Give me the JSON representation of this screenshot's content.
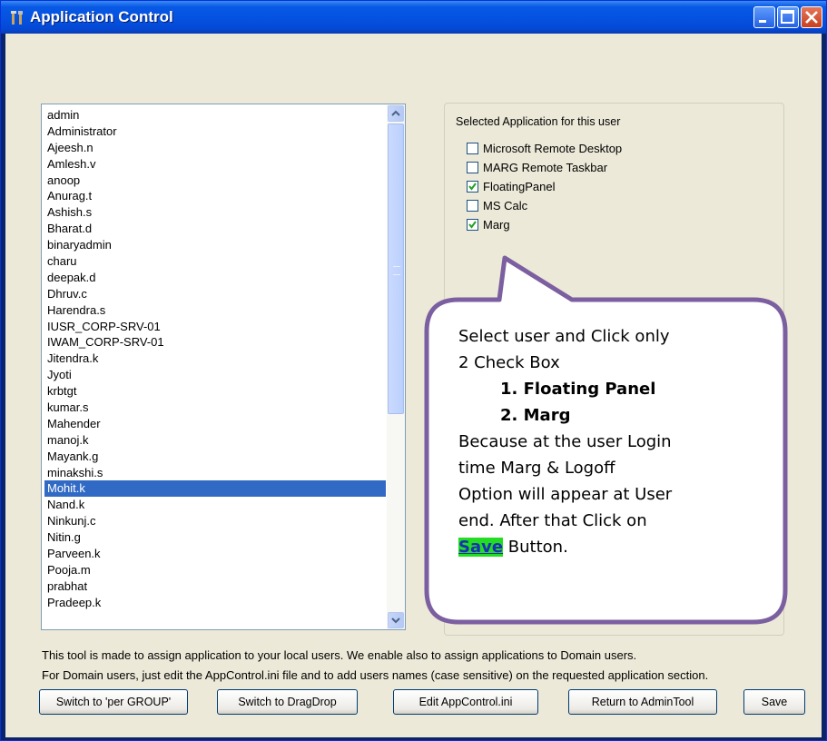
{
  "window": {
    "title": "Application Control"
  },
  "users": {
    "items": [
      "admin",
      "Administrator",
      "Ajeesh.n",
      "Amlesh.v",
      "anoop",
      "Anurag.t",
      "Ashish.s",
      "Bharat.d",
      "binaryadmin",
      "charu",
      "deepak.d",
      "Dhruv.c",
      "Harendra.s",
      "IUSR_CORP-SRV-01",
      "IWAM_CORP-SRV-01",
      "Jitendra.k",
      "Jyoti",
      "krbtgt",
      "kumar.s",
      "Mahender",
      "manoj.k",
      "Mayank.g",
      "minakshi.s",
      "Mohit.k",
      "Nand.k",
      "Ninkunj.c",
      "Nitin.g",
      "Parveen.k",
      "Pooja.m",
      "prabhat",
      "Pradeep.k"
    ],
    "selected_index": 23
  },
  "applications": {
    "label": "Selected Application for this user",
    "items": [
      {
        "label": "Microsoft Remote Desktop",
        "checked": false
      },
      {
        "label": "MARG Remote Taskbar",
        "checked": false
      },
      {
        "label": "FloatingPanel",
        "checked": true
      },
      {
        "label": "MS Calc",
        "checked": false
      },
      {
        "label": "Marg",
        "checked": true
      }
    ]
  },
  "info": {
    "line1": "This tool is made to assign application to your local users. We enable also to assign applications to Domain users.",
    "line2": "For Domain users, just edit the AppControl.ini file and to add users names (case sensitive) on the requested application section."
  },
  "buttons": {
    "per_group": "Switch to 'per GROUP'",
    "drag_drop": "Switch to DragDrop",
    "edit_ini": "Edit AppControl.ini",
    "return_admin": "Return to AdminTool",
    "save": "Save"
  },
  "callout": {
    "line1": "Select user and Click only",
    "line2": "2 Check Box",
    "item1": "1.   Floating Panel",
    "item2": "2.   Marg",
    "line3": "Because at the user Login",
    "line4": "time Marg & Logoff",
    "line5": "Option will appear at User",
    "line6": "end.  After that Click on",
    "save_word": "Save",
    "line7_rest": " Button."
  },
  "colors": {
    "title_bar": "#0553e1",
    "selection": "#316ac5",
    "callout_border": "#7b5fa0",
    "save_highlight": "#22dd22"
  }
}
